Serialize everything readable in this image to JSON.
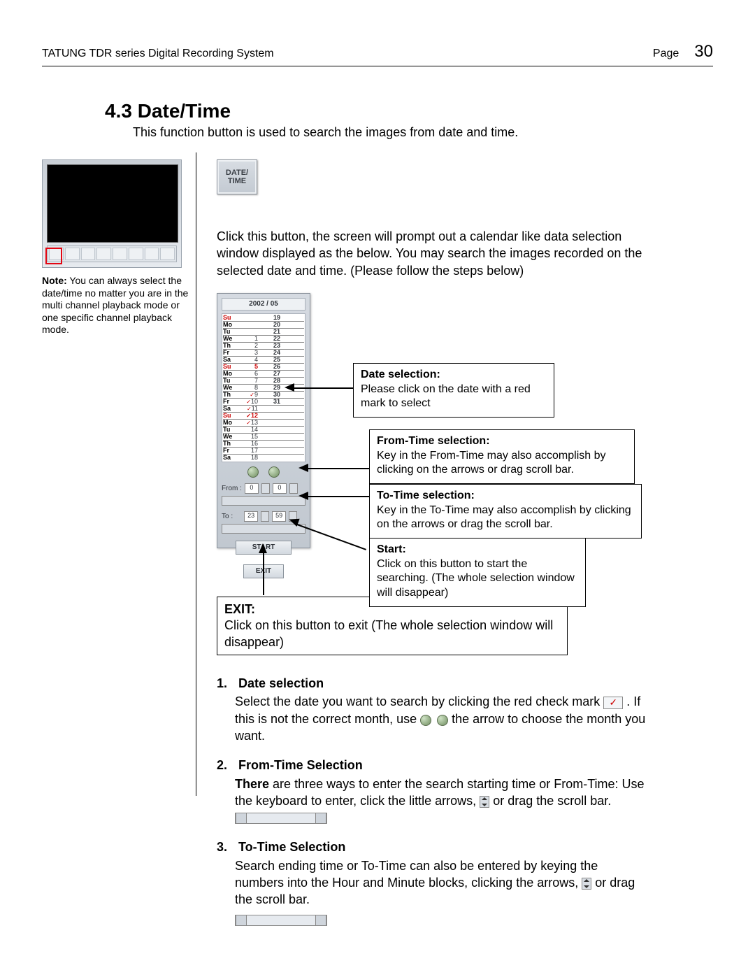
{
  "header": {
    "title": "TATUNG TDR series Digital Recording System",
    "page_label": "Page",
    "page_number": "30"
  },
  "section": {
    "title": "4.3 Date/Time",
    "intro": "This function button is used to search the images from date and time."
  },
  "note": {
    "prefix": "Note:",
    "text": "You can always select the date/time no matter you are in the multi channel playback mode or one specific channel playback mode."
  },
  "date_time_button": "DATE/\nTIME",
  "intro2": "Click this button, the screen will prompt out a calendar like data selection window displayed as the below. You may search the images recorded on the selected date and time. (Please follow the steps below)",
  "panel": {
    "title": "2002 / 05",
    "rows": [
      {
        "d": "Su",
        "c1": "",
        "c2": "19",
        "red": true
      },
      {
        "d": "Mo",
        "c1": "",
        "c2": "20"
      },
      {
        "d": "Tu",
        "c1": "",
        "c2": "21"
      },
      {
        "d": "We",
        "c1": "1",
        "c2": "22"
      },
      {
        "d": "Th",
        "c1": "2",
        "c2": "23"
      },
      {
        "d": "Fr",
        "c1": "3",
        "c2": "24"
      },
      {
        "d": "Sa",
        "c1": "4",
        "c2": "25"
      },
      {
        "d": "Su",
        "c1": "5",
        "c2": "26",
        "red": true
      },
      {
        "d": "Mo",
        "c1": "6",
        "c2": "27"
      },
      {
        "d": "Tu",
        "c1": "7",
        "c2": "28"
      },
      {
        "d": "We",
        "c1": "8",
        "c2": "29"
      },
      {
        "d": "Th",
        "c1": "9",
        "c2": "30",
        "chk": true
      },
      {
        "d": "Fr",
        "c1": "10",
        "c2": "31",
        "chk": true
      },
      {
        "d": "Sa",
        "c1": "11",
        "chk": true
      },
      {
        "d": "Su",
        "c1": "12",
        "red": true,
        "chk": true
      },
      {
        "d": "Mo",
        "c1": "13",
        "chk": true
      },
      {
        "d": "Tu",
        "c1": "14"
      },
      {
        "d": "We",
        "c1": "15"
      },
      {
        "d": "Th",
        "c1": "16"
      },
      {
        "d": "Fr",
        "c1": "17"
      },
      {
        "d": "Sa",
        "c1": "18"
      }
    ],
    "from_label": "From :",
    "from_h": "0",
    "from_m": "0",
    "to_label": "To :",
    "to_h": "23",
    "to_m": "59",
    "start": "START",
    "exit": "EXIT"
  },
  "callouts": {
    "date": {
      "title": "Date selection:",
      "body": "Please click on the date with a red mark to select"
    },
    "from": {
      "title": "From-Time selection:",
      "body": "Key in the From-Time may also accomplish by clicking on the arrows or drag scroll bar."
    },
    "to": {
      "title": "To-Time selection:",
      "body": "Key in the To-Time may also accomplish by clicking on the arrows or drag the scroll bar."
    },
    "start": {
      "title": "Start:",
      "body": "Click on this button to start the searching. (The whole selection window will disappear)"
    },
    "exit": {
      "title": "EXIT:",
      "body": "Click on this button to exit (The whole selection window will disappear)"
    }
  },
  "steps": {
    "s1": {
      "num": "1.",
      "title": "Date selection",
      "body_a": "Select the date you want to search by clicking the red check mark ",
      "body_b": ". If this is not the correct month, use ",
      "body_c": " the arrow   to choose the month you want."
    },
    "s2": {
      "num": "2.",
      "title": "From-Time Selection",
      "body_a": "There",
      "body_b": " are three ways to enter the search starting time or From-Time: Use the keyboard to enter, click the little arrows, ",
      "body_c": "or drag the scroll bar. "
    },
    "s3": {
      "num": "3.",
      "title": "To-Time Selection",
      "body_a": "Search ending time or To-Time can also be entered by keying the numbers into the Hour and Minute blocks, clicking the arrows, ",
      "body_b": "or drag the scroll bar."
    }
  }
}
